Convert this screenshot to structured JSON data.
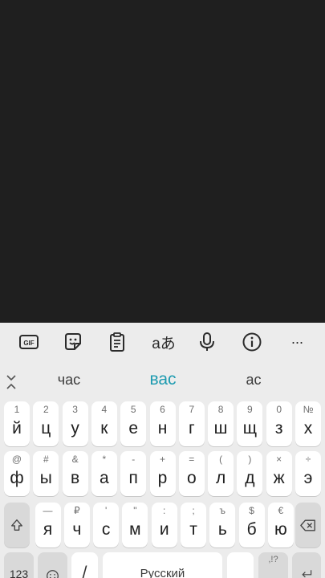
{
  "toolbar": {
    "gif": "GIF",
    "translate_glyph": "aあ",
    "more": "···"
  },
  "suggestions": [
    "час",
    "вас",
    "ас"
  ],
  "rows": [
    [
      {
        "hint": "1",
        "main": "й"
      },
      {
        "hint": "2",
        "main": "ц"
      },
      {
        "hint": "3",
        "main": "у"
      },
      {
        "hint": "4",
        "main": "к"
      },
      {
        "hint": "5",
        "main": "е"
      },
      {
        "hint": "6",
        "main": "н"
      },
      {
        "hint": "7",
        "main": "г"
      },
      {
        "hint": "8",
        "main": "ш"
      },
      {
        "hint": "9",
        "main": "щ"
      },
      {
        "hint": "0",
        "main": "з"
      },
      {
        "hint": "№",
        "main": "х"
      }
    ],
    [
      {
        "hint": "@",
        "main": "ф"
      },
      {
        "hint": "#",
        "main": "ы"
      },
      {
        "hint": "&",
        "main": "в"
      },
      {
        "hint": "*",
        "main": "а"
      },
      {
        "hint": "-",
        "main": "п"
      },
      {
        "hint": "+",
        "main": "р"
      },
      {
        "hint": "=",
        "main": "о"
      },
      {
        "hint": "(",
        "main": "л"
      },
      {
        "hint": ")",
        "main": "д"
      },
      {
        "hint": "×",
        "main": "ж"
      },
      {
        "hint": "÷",
        "main": "э"
      }
    ],
    [
      {
        "hint": "—",
        "main": "я"
      },
      {
        "hint": "₽",
        "main": "ч"
      },
      {
        "hint": "'",
        "main": "с"
      },
      {
        "hint": "\"",
        "main": "м"
      },
      {
        "hint": ":",
        "main": "и"
      },
      {
        "hint": ";",
        "main": "т"
      },
      {
        "hint": "ъ",
        "main": "ь"
      },
      {
        "hint": "$",
        "main": "б"
      },
      {
        "hint": "€",
        "main": "ю"
      }
    ]
  ],
  "bottom": {
    "sym_label": "123",
    "slash_label": "/",
    "space_label": "Русский",
    "punct_hint": ",!?"
  },
  "colors": {
    "background": "#1f1f1f",
    "keyboard": "#ececec",
    "key": "#ffffff",
    "accent": "#1e9bb0"
  }
}
